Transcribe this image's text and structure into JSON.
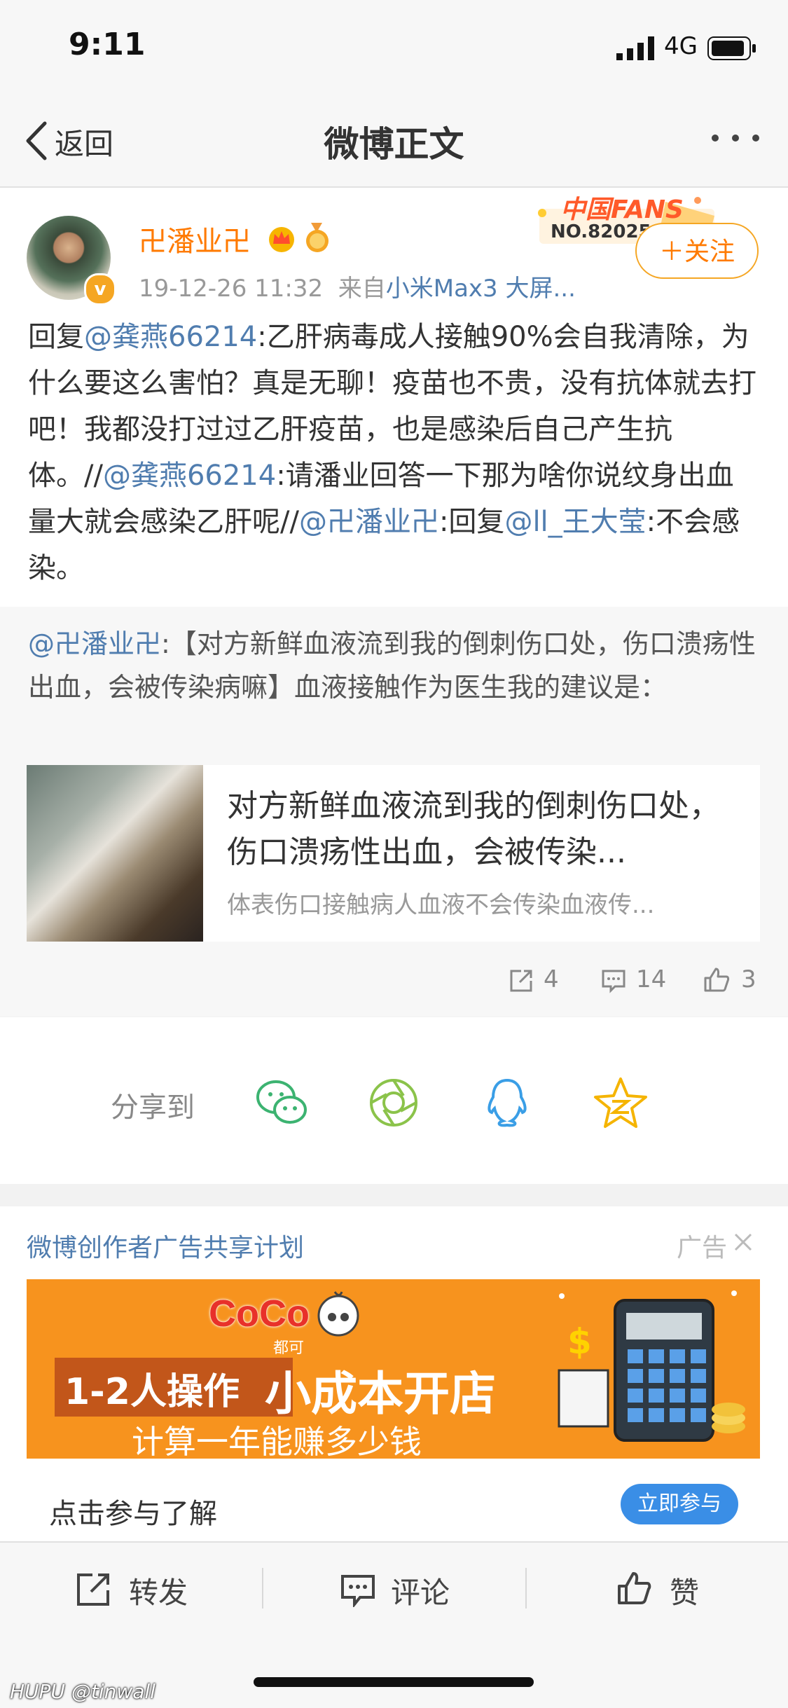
{
  "status_bar": {
    "time": "9:11",
    "network": "4G"
  },
  "nav": {
    "back_label": "返回",
    "title": "微博正文"
  },
  "post": {
    "username": "卍潘业卍",
    "timestamp": "19-12-26 11:32",
    "source_prefix": "来自",
    "source": "小米Max3 大屏...",
    "follow_label": "＋关注",
    "fans_badge_title": "中国FANS",
    "fans_badge_no": "NO.82025",
    "text": [
      {
        "t": "回复",
        "m": false
      },
      {
        "t": "@龚燕66214",
        "m": true
      },
      {
        "t": ":乙肝病毒成人接触90%会自我清除，为什么要这么害怕？真是无聊！疫苗也不贵，没有抗体就去打吧！我都没打过过乙肝疫苗，也是感染后自己产生抗体。//",
        "m": false
      },
      {
        "t": "@龚燕66214",
        "m": true
      },
      {
        "t": ":请潘业回答一下那为啥你说纹身出血量大就会感染乙肝呢//",
        "m": false
      },
      {
        "t": "@卍潘业卍",
        "m": true
      },
      {
        "t": ":回复",
        "m": false
      },
      {
        "t": "@ll_王大莹",
        "m": true
      },
      {
        "t": ":不会感染。",
        "m": false
      }
    ]
  },
  "repost": {
    "author": "@卍潘业卍",
    "text": ":【对方新鲜血液流到我的倒刺伤口处，伤口溃疡性出血，会被传染病嘛】血液接触作为医生我的建议是：",
    "link_title": "对方新鲜血液流到我的倒刺伤口处，伤口溃疡性出血，会被传染...",
    "link_desc": "体表伤口接触病人血液不会传染血液传..."
  },
  "stats": {
    "reposts": "4",
    "comments": "14",
    "likes": "3"
  },
  "share": {
    "label": "分享到"
  },
  "ad": {
    "title": "微博创作者广告共享计划",
    "tag": "广告",
    "brand": "CoCo",
    "brand_sub": "都可",
    "headline_left": "1-2人操作",
    "headline_right": "小成本开店",
    "subline": "计算一年能赚多少钱",
    "cta_text": "点击参与了解",
    "cta_button": "立即参与"
  },
  "bottom_bar": {
    "repost": "转发",
    "comment": "评论",
    "like": "赞"
  },
  "watermark": {
    "brand": "HUPU",
    "user": "@tinwall"
  },
  "colors": {
    "accent_orange": "#ff7a00",
    "link_blue": "#507daf",
    "ad_orange": "#f7931e",
    "cta_blue": "#3a8ee6"
  }
}
